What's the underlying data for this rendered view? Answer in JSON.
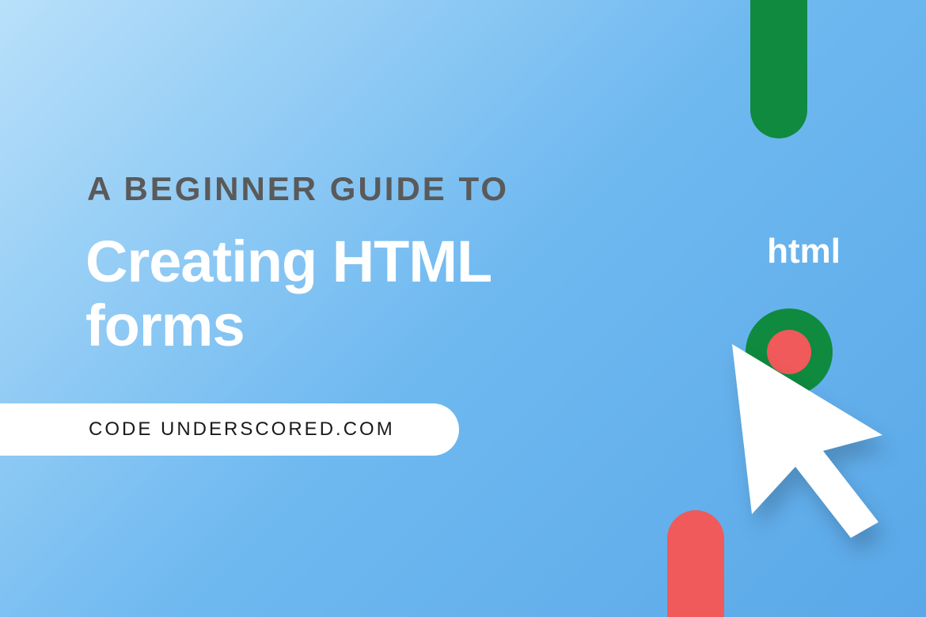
{
  "pretitle": "A BEGINNER GUIDE TO",
  "title_line1": "Creating HTML",
  "title_line2": "forms",
  "pill_text": "CODE UNDERSCORED.COM",
  "html_label": "html",
  "colors": {
    "green": "#0f8a3f",
    "red": "#f05a5a",
    "white": "#ffffff",
    "gray": "#5a5a5a",
    "gradient_start": "#b8e0fa",
    "gradient_end": "#5aa8e8"
  }
}
